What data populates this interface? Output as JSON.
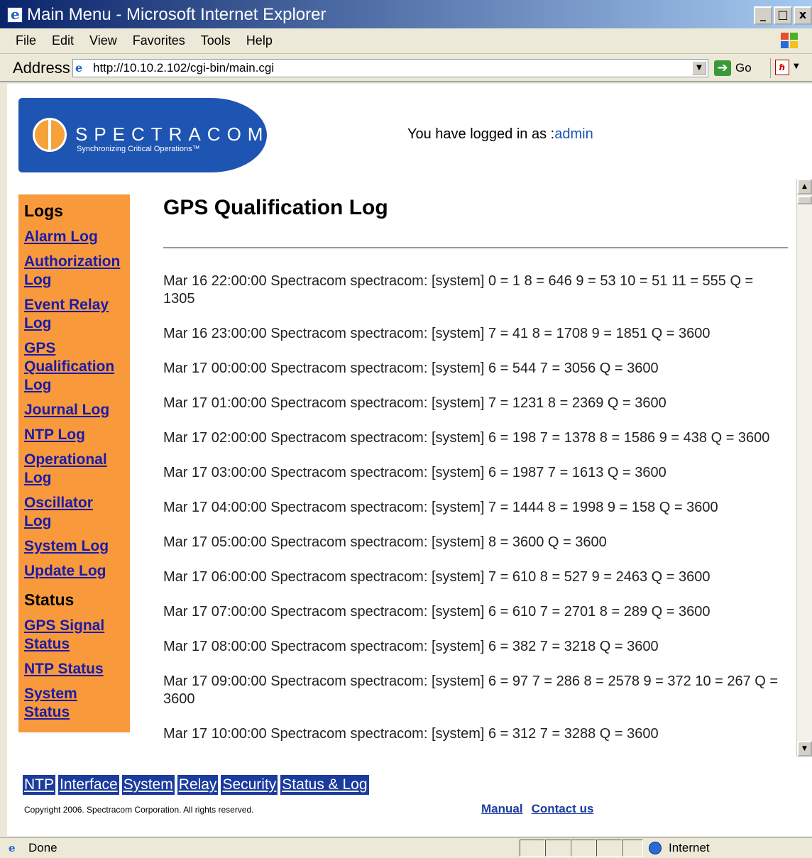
{
  "window": {
    "title": "Main Menu - Microsoft Internet Explorer",
    "buttons": [
      "_",
      "□",
      "x"
    ]
  },
  "menubar": {
    "items": [
      "File",
      "Edit",
      "View",
      "Favorites",
      "Tools",
      "Help"
    ]
  },
  "addressbar": {
    "label": "Address",
    "url": "http://10.10.2.102/cgi-bin/main.cgi",
    "go_label": "Go"
  },
  "header": {
    "brand": "SPECTRACOM",
    "tagline": "Synchronizing Critical Operations™",
    "logged_in_prefix": "You have logged in as :",
    "username": "admin"
  },
  "sidebar": {
    "logs_heading": "Logs",
    "log_links": [
      "Alarm Log",
      "Authorization Log",
      "Event Relay Log",
      "GPS Qualification Log",
      "Journal Log",
      "NTP Log",
      "Operational Log",
      "Oscillator Log",
      "System Log",
      "Update Log"
    ],
    "status_heading": "Status",
    "status_links": [
      "GPS Signal Status",
      "NTP Status",
      "System Status"
    ]
  },
  "main": {
    "title": "GPS Qualification Log",
    "entries": [
      "Mar 16 22:00:00 Spectracom spectracom: [system] 0 = 1 8 = 646 9 = 53 10 = 51 11 = 555 Q = 1305",
      "Mar 16 23:00:00 Spectracom spectracom: [system] 7 = 41 8 = 1708 9 = 1851 Q = 3600",
      "Mar 17 00:00:00 Spectracom spectracom: [system] 6 = 544 7 = 3056 Q = 3600",
      "Mar 17 01:00:00 Spectracom spectracom: [system] 7 = 1231 8 = 2369 Q = 3600",
      "Mar 17 02:00:00 Spectracom spectracom: [system] 6 = 198 7 = 1378 8 = 1586 9 = 438 Q = 3600",
      "Mar 17 03:00:00 Spectracom spectracom: [system] 6 = 1987 7 = 1613 Q = 3600",
      "Mar 17 04:00:00 Spectracom spectracom: [system] 7 = 1444 8 = 1998 9 = 158 Q = 3600",
      "Mar 17 05:00:00 Spectracom spectracom: [system] 8 = 3600 Q = 3600",
      "Mar 17 06:00:00 Spectracom spectracom: [system] 7 = 610 8 = 527 9 = 2463 Q = 3600",
      "Mar 17 07:00:00 Spectracom spectracom: [system] 6 = 610 7 = 2701 8 = 289 Q = 3600",
      "Mar 17 08:00:00 Spectracom spectracom: [system] 6 = 382 7 = 3218 Q = 3600",
      "Mar 17 09:00:00 Spectracom spectracom: [system] 6 = 97 7 = 286 8 = 2578 9 = 372 10 = 267 Q = 3600",
      "Mar 17 10:00:00 Spectracom spectracom: [system] 6 = 312 7 = 3288 Q = 3600"
    ]
  },
  "bottom_nav": {
    "items": [
      "NTP",
      "Interface",
      "System",
      "Relay",
      "Security",
      "Status & Log"
    ]
  },
  "footer": {
    "copyright": "Copyright 2006. Spectracom Corporation. All rights reserved.",
    "manual": "Manual",
    "contact": "Contact us"
  },
  "statusbar": {
    "status": "Done",
    "zone": "Internet"
  },
  "colors": {
    "sidebar_bg": "#f89a3c",
    "link": "#1b1ba8",
    "nav_bg": "#1b3c9e",
    "logo_bg": "#1e55b3"
  }
}
